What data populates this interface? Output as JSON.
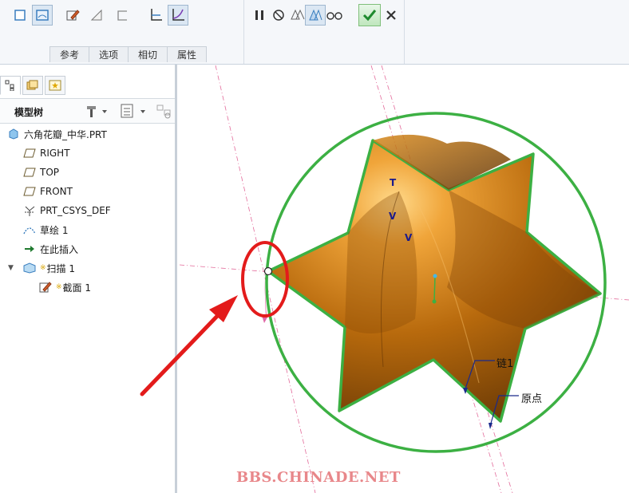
{
  "ribbon": {
    "tabs": [
      "参考",
      "选项",
      "相切",
      "属性"
    ],
    "tools_left": [
      "solid-icon",
      "surface-icon",
      "sketch-icon",
      "thicken-icon",
      "remove-icon",
      "constant-section-icon",
      "variable-section-icon"
    ],
    "tools_right": [
      "pause-icon",
      "no-preview-icon",
      "geometry-preview-icon",
      "feature-preview-icon",
      "glasses-icon"
    ]
  },
  "panel": {
    "tree_title": "模型树",
    "items": [
      {
        "label": "六角花瓣_中华.PRT",
        "icon": "part-icon"
      },
      {
        "label": "RIGHT",
        "icon": "datum-plane-icon"
      },
      {
        "label": "TOP",
        "icon": "datum-plane-icon"
      },
      {
        "label": "FRONT",
        "icon": "datum-plane-icon"
      },
      {
        "label": "PRT_CSYS_DEF",
        "icon": "csys-icon"
      },
      {
        "label": "草绘 1",
        "icon": "sketch-icon"
      },
      {
        "label": "在此插入",
        "icon": "insert-arrow-icon"
      },
      {
        "label": "扫描 1",
        "icon": "sweep-icon"
      },
      {
        "label": "截面 1",
        "icon": "section-icon"
      }
    ]
  },
  "viewport": {
    "chain_label": "链1",
    "origin_label": "原点",
    "dim_t": "T",
    "dim_v1": "V",
    "dim_v2": "V",
    "watermark": "BBS.CHINADE.NET",
    "colors": {
      "surface": "#c86f00",
      "outline": "#3cb043",
      "highlight": "#e31b1b",
      "datum": "#e36a9a"
    }
  }
}
